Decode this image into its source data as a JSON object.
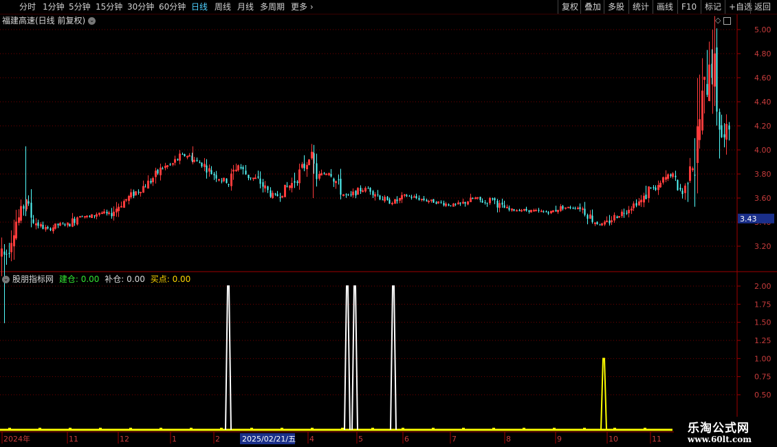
{
  "toolbar": {
    "periods": [
      "分时",
      "1分钟",
      "5分钟",
      "15分钟",
      "30分钟",
      "60分钟",
      "日线",
      "周线",
      "月线",
      "多周期",
      "更多"
    ],
    "active_period": "日线",
    "more_arrow": "›",
    "right_buttons": [
      "复权",
      "叠加",
      "多股",
      "统计",
      "画线",
      "F10",
      "标记",
      "+自选",
      "返回"
    ]
  },
  "main_chart": {
    "title": "福建高速(日线 前复权)",
    "title_menu_icon": "chevron-down-icon",
    "top_right_icons": [
      "diamond-icon",
      "layout-icon"
    ],
    "y_labels": [
      "5.00",
      "4.80",
      "4.60",
      "4.40",
      "4.20",
      "4.00",
      "3.80",
      "3.60",
      "3.40",
      "3.20"
    ],
    "current_price": "3.43",
    "up_color": "#ff3b3b",
    "down_color": "#54ffff"
  },
  "indicator": {
    "name": "股朋指标网",
    "items": [
      {
        "label": "建仓",
        "value": "0.00",
        "color": "#33e633"
      },
      {
        "label": "补仓",
        "value": "0.00",
        "color": "#d8d8d8"
      },
      {
        "label": "买点",
        "value": "0.00",
        "color": "#ffd700"
      }
    ],
    "y_labels": [
      "2.00",
      "1.75",
      "1.50",
      "1.25",
      "1.00",
      "0.75",
      "0.50"
    ]
  },
  "x_axis": {
    "labels": [
      "2024年",
      "11",
      "12",
      "1",
      "2",
      "4",
      "5",
      "6",
      "7",
      "8",
      "9",
      "10",
      "11"
    ],
    "cursor_date": "2025/02/21/五"
  },
  "watermark": {
    "line1": "乐淘公式网",
    "line2": "www.60lt.com"
  },
  "chart_data": {
    "type": "candlestick",
    "title": "福建高速(日线 前复权)",
    "ylim": [
      3.08,
      5.05
    ],
    "x_months": [
      "2024年",
      "11",
      "12",
      "1",
      "2",
      "4",
      "5",
      "6",
      "7",
      "8",
      "9",
      "10",
      "11"
    ],
    "price_path": [
      [
        0,
        3.12
      ],
      [
        5,
        3.12
      ],
      [
        10,
        3.15
      ],
      [
        15,
        3.28
      ],
      [
        22,
        3.4
      ],
      [
        30,
        3.45
      ],
      [
        35,
        3.55
      ],
      [
        38,
        3.6
      ],
      [
        42,
        3.48
      ],
      [
        50,
        3.4
      ],
      [
        60,
        3.36
      ],
      [
        70,
        3.34
      ],
      [
        85,
        3.38
      ],
      [
        100,
        3.38
      ],
      [
        115,
        3.46
      ],
      [
        130,
        3.44
      ],
      [
        145,
        3.48
      ],
      [
        160,
        3.46
      ],
      [
        175,
        3.55
      ],
      [
        190,
        3.62
      ],
      [
        205,
        3.68
      ],
      [
        220,
        3.75
      ],
      [
        235,
        3.85
      ],
      [
        250,
        3.88
      ],
      [
        262,
        3.95
      ],
      [
        275,
        3.95
      ],
      [
        285,
        3.9
      ],
      [
        295,
        3.88
      ],
      [
        305,
        3.82
      ],
      [
        320,
        3.76
      ],
      [
        332,
        3.72
      ],
      [
        345,
        3.88
      ],
      [
        360,
        3.78
      ],
      [
        375,
        3.75
      ],
      [
        385,
        3.68
      ],
      [
        395,
        3.62
      ],
      [
        405,
        3.62
      ],
      [
        415,
        3.68
      ],
      [
        425,
        3.72
      ],
      [
        440,
        3.85
      ],
      [
        452,
        3.95
      ],
      [
        460,
        3.78
      ],
      [
        470,
        3.8
      ],
      [
        480,
        3.82
      ],
      [
        490,
        3.72
      ],
      [
        500,
        3.62
      ],
      [
        510,
        3.62
      ],
      [
        520,
        3.66
      ],
      [
        535,
        3.68
      ],
      [
        550,
        3.62
      ],
      [
        565,
        3.56
      ],
      [
        578,
        3.58
      ],
      [
        590,
        3.62
      ],
      [
        605,
        3.6
      ],
      [
        620,
        3.58
      ],
      [
        640,
        3.56
      ],
      [
        655,
        3.54
      ],
      [
        670,
        3.55
      ],
      [
        690,
        3.6
      ],
      [
        705,
        3.56
      ],
      [
        715,
        3.6
      ],
      [
        725,
        3.54
      ],
      [
        740,
        3.5
      ],
      [
        760,
        3.5
      ],
      [
        780,
        3.49
      ],
      [
        800,
        3.48
      ],
      [
        815,
        3.52
      ],
      [
        830,
        3.52
      ],
      [
        845,
        3.52
      ],
      [
        855,
        3.46
      ],
      [
        865,
        3.4
      ],
      [
        875,
        3.38
      ],
      [
        885,
        3.4
      ],
      [
        895,
        3.45
      ],
      [
        905,
        3.48
      ],
      [
        915,
        3.52
      ],
      [
        925,
        3.56
      ],
      [
        935,
        3.58
      ],
      [
        945,
        3.7
      ],
      [
        955,
        3.66
      ],
      [
        965,
        3.75
      ],
      [
        975,
        3.8
      ],
      [
        985,
        3.7
      ],
      [
        995,
        3.62
      ],
      [
        1002,
        3.92
      ],
      [
        1010,
        3.86
      ],
      [
        1018,
        4.3
      ],
      [
        1025,
        4.45
      ],
      [
        1032,
        4.8
      ],
      [
        1038,
        4.6
      ],
      [
        1045,
        4.3
      ],
      [
        1050,
        4.1
      ],
      [
        1055,
        4.05
      ],
      [
        1061,
        4.25
      ]
    ],
    "signals": [
      {
        "series": "建仓",
        "color": "#ffffff",
        "x": [
          332,
          505,
          516,
          572
        ],
        "y": [
          2,
          2,
          2,
          2
        ]
      },
      {
        "series": "买点",
        "color": "#ffff00",
        "x": [
          878
        ],
        "y": [
          1
        ]
      }
    ]
  }
}
